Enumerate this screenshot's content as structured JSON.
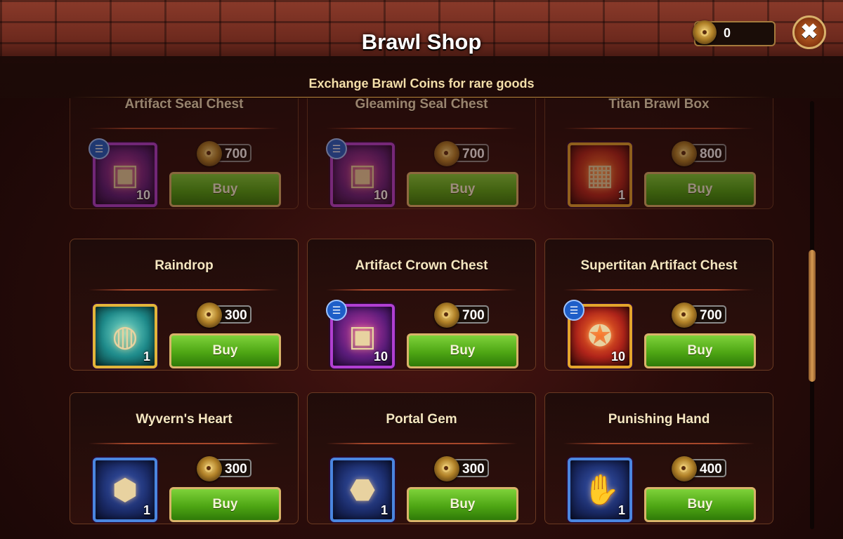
{
  "header": {
    "title": "Brawl Shop",
    "subtitle": "Exchange Brawl Coins for rare goods",
    "coin_balance": "0",
    "close_label": "✖"
  },
  "items": [
    {
      "name": "Artifact Seal Chest",
      "price": "700",
      "qty": "10",
      "frame": "purple",
      "has_info": true,
      "buy_label": "Buy"
    },
    {
      "name": "Gleaming Seal Chest",
      "price": "700",
      "qty": "10",
      "frame": "purple",
      "has_info": true,
      "buy_label": "Buy"
    },
    {
      "name": "Titan Brawl Box",
      "price": "800",
      "qty": "1",
      "frame": "orange",
      "has_info": false,
      "buy_label": "Buy"
    },
    {
      "name": "Raindrop",
      "price": "300",
      "qty": "1",
      "frame": "gold-teal",
      "has_info": false,
      "buy_label": "Buy"
    },
    {
      "name": "Artifact Crown Chest",
      "price": "700",
      "qty": "10",
      "frame": "purple",
      "has_info": true,
      "buy_label": "Buy"
    },
    {
      "name": "Supertitan Artifact Chest",
      "price": "700",
      "qty": "10",
      "frame": "orange",
      "has_info": true,
      "buy_label": "Buy"
    },
    {
      "name": "Wyvern's Heart",
      "price": "300",
      "qty": "1",
      "frame": "blue",
      "has_info": false,
      "buy_label": "Buy"
    },
    {
      "name": "Portal Gem",
      "price": "300",
      "qty": "1",
      "frame": "blue",
      "has_info": false,
      "buy_label": "Buy"
    },
    {
      "name": "Punishing Hand",
      "price": "400",
      "qty": "1",
      "frame": "blue",
      "has_info": false,
      "buy_label": "Buy"
    }
  ],
  "colors": {
    "buy_green": "#4ea614",
    "frame_gold": "#d9b36a",
    "title_text": "#ffffff",
    "subtitle_text": "#f4dfaa"
  },
  "icons": [
    "coin-icon",
    "close-icon",
    "info-icon",
    "chest-icon",
    "titan-box-icon",
    "raindrop-jar-icon",
    "wyvern-heart-icon",
    "portal-gem-icon",
    "punishing-hand-icon"
  ]
}
